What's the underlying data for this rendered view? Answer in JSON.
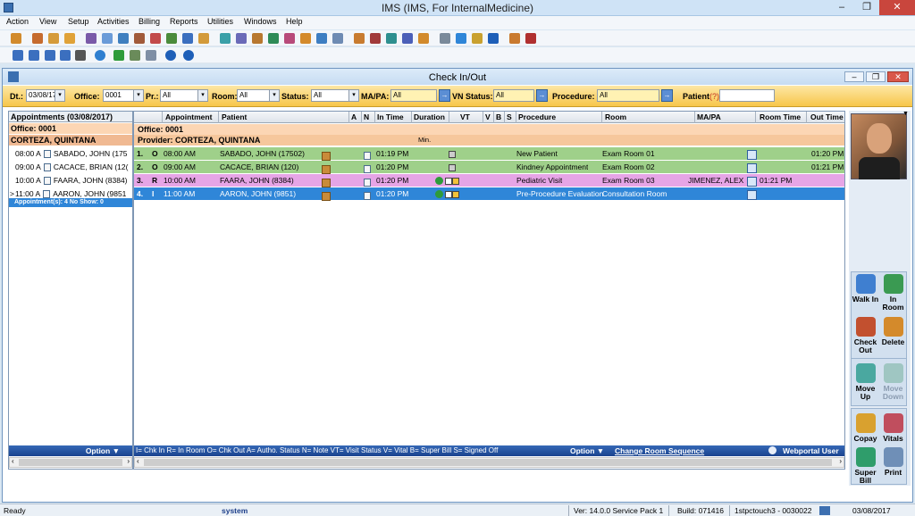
{
  "app": {
    "title": "IMS (IMS, For InternalMedicine)"
  },
  "menu": [
    "Action",
    "View",
    "Setup",
    "Activities",
    "Billing",
    "Reports",
    "Utilities",
    "Windows",
    "Help"
  ],
  "window": {
    "title": "Check In/Out"
  },
  "filters": {
    "dt_label": "Dt.:",
    "dt_value": "03/08/17",
    "office_label": "Office:",
    "office_value": "0001",
    "pr_label": "Pr.:",
    "pr_value": "All",
    "room_label": "Room:",
    "room_value": "All",
    "status_label": "Status:",
    "status_value": "All",
    "mapa_label": "MA/PA:",
    "mapa_value": "All",
    "vn_label": "VN Status:",
    "vn_value": "All",
    "procedure_label": "Procedure:",
    "procedure_value": "All",
    "patient_label": "Patient",
    "patient_hint": "(?)",
    "patient_value": ""
  },
  "left": {
    "header": "Appointments (03/08/2017)",
    "office": "Office: 0001",
    "provider": "CORTEZA, QUINTANA",
    "rows": [
      {
        "marker": "",
        "time": "08:00 A",
        "name": "SABADO, JOHN  (175"
      },
      {
        "marker": "",
        "time": "09:00 A",
        "name": "CACACE, BRIAN  (12("
      },
      {
        "marker": "",
        "time": "10:00 A",
        "name": "FAARA, JOHN  (8384)"
      },
      {
        "marker": ">",
        "time": "11:00 A",
        "name": "AARON, JOHN  (9851"
      }
    ],
    "summary": "Appointment(s): 4   No Show: 0",
    "option_label": "Option"
  },
  "grid": {
    "columns": [
      "Appointment",
      "Patient",
      "A",
      "N",
      "In Time",
      "Duration",
      "VT",
      "V",
      "B",
      "S",
      "Procedure",
      "Room",
      "MA/PA",
      "Room Time",
      "Out Time"
    ],
    "office": "Office: 0001",
    "provider": "Provider: CORTEZA, QUINTANA",
    "min_label": "Min.",
    "rows": [
      {
        "num": "1.",
        "status": "O",
        "time": "08:00 AM",
        "patient": "SABADO, JOHN  (17502)",
        "in_time": "01:19 PM",
        "procedure": "New Patient",
        "room": "Exam Room 01",
        "mapa": "",
        "room_time": "",
        "out_time": "01:20 PM"
      },
      {
        "num": "2.",
        "status": "O",
        "time": "09:00 AM",
        "patient": "CACACE, BRIAN  (120)",
        "in_time": "01:20 PM",
        "procedure": "Kindney Appointment",
        "room": "Exam Room 02",
        "mapa": "",
        "room_time": "",
        "out_time": "01:21 PM"
      },
      {
        "num": "3.",
        "status": "R",
        "time": "10:00 AM",
        "patient": "FAARA, JOHN  (8384)",
        "in_time": "01:20 PM",
        "procedure": "Pediatric Visit",
        "room": "Exam Room 03",
        "mapa": "JIMENEZ, ALEX",
        "room_time": "01:21 PM",
        "out_time": ""
      },
      {
        "num": "4.",
        "status": "I",
        "time": "11:00 AM",
        "patient": "AARON, JOHN  (9851)",
        "in_time": "01:20 PM",
        "procedure": "Pre-Procedure Evaluation",
        "room": "Consultation Room",
        "mapa": "",
        "room_time": "",
        "out_time": ""
      }
    ],
    "legend": "I= Chk In  R= In Room O= Chk Out  A= Autho. Status  N= Note  VT= Visit Status  V= Vital  B= Super Bill  S= Signed Off",
    "option_label": "Option",
    "change_room": "Change Room Sequence",
    "webportal": "Webportal User"
  },
  "actions": [
    {
      "label": "Walk In",
      "color": "#3f7fd0",
      "enabled": true
    },
    {
      "label": "In Room",
      "color": "#3a9a52",
      "enabled": true
    },
    {
      "label": "Check Out",
      "color": "#c2502f",
      "enabled": true
    },
    {
      "label": "Delete",
      "color": "#d48a2b",
      "enabled": true
    },
    {
      "label": "Move Up",
      "color": "#4aa8a0",
      "enabled": true
    },
    {
      "label": "Move Down",
      "color": "#9fc6c2",
      "enabled": false
    },
    {
      "label": "Copay",
      "color": "#d9a12f",
      "enabled": true
    },
    {
      "label": "Vitals",
      "color": "#c04e5e",
      "enabled": true
    },
    {
      "label": "Super Bill",
      "color": "#2f9d6b",
      "enabled": true
    },
    {
      "label": "Print",
      "color": "#6f8fb7",
      "enabled": true
    }
  ],
  "status": {
    "ready": "Ready",
    "user": "system",
    "version": "Ver: 14.0.0 Service Pack 1",
    "build": "Build: 071416",
    "server": "1stpctouch3 - 0030022",
    "date": "03/08/2017"
  },
  "colors": {
    "row_green": "#9fd08a",
    "row_pink": "#e6a5e6",
    "row_selected": "#2f86d8",
    "filter_bar": "#f7c64a",
    "office_band": "#fcd6b4"
  }
}
